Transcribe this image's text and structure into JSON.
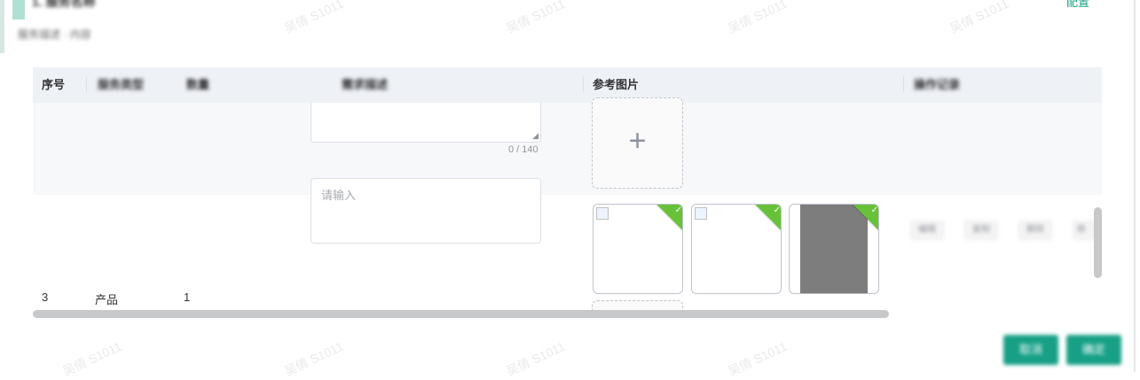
{
  "header": {
    "title": "1. 服务名称",
    "subtitle": "服务描述 · 内容",
    "right_link": "配置"
  },
  "table": {
    "columns": [
      {
        "label": "序号"
      },
      {
        "label": "服务类型"
      },
      {
        "label": "数量"
      },
      {
        "label": "需求描述"
      },
      {
        "label": "参考图片"
      },
      {
        "label": "操作记录"
      }
    ],
    "row1": {
      "textarea_counter": "0 / 140"
    },
    "row2": {
      "index": "3",
      "type": "产品",
      "quantity": "1",
      "input_placeholder": "请输入",
      "pills": [
        "编辑",
        "复制",
        "删除",
        "移"
      ]
    }
  },
  "footer": {
    "cancel_label": "取消",
    "confirm_label": "确定"
  },
  "watermark_text": "吴倩 S1011",
  "colors": {
    "accent": "#17a086",
    "success_badge": "#67c23a",
    "header_bg": "#eef1f6"
  }
}
